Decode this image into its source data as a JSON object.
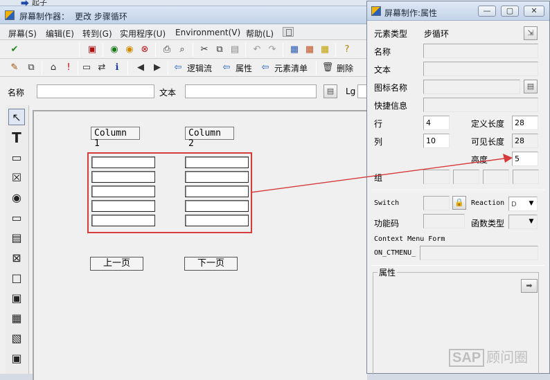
{
  "top": {
    "partial_text": "起子"
  },
  "main": {
    "title": "屏幕制作器：",
    "subtitle": "更改 步骤循环",
    "menu": [
      "屏幕(S)",
      "编辑(E)",
      "转到(G)",
      "实用程序(U)",
      "Environment(V)",
      "帮助(L)"
    ],
    "toolbar2_labels": {
      "flow": "逻辑流",
      "attrs": "属性",
      "elements": "元素清单",
      "delete": "删除"
    },
    "field_labels": {
      "name": "名称",
      "text": "文本",
      "lg": "Lg"
    },
    "columns": [
      "Column 1",
      "Column 2"
    ],
    "buttons": {
      "prev": "上一页",
      "next": "下一页"
    }
  },
  "props": {
    "title": "屏幕制作:属性",
    "element_type_label": "元素类型",
    "element_type_value": "步循环",
    "name_label": "名称",
    "text_label": "文本",
    "icon_label": "图标名称",
    "quickinfo_label": "快捷信息",
    "row_label": "行",
    "row_value": "4",
    "col_label": "列",
    "col_value": "10",
    "deflen_label": "定义长度",
    "deflen_value": "28",
    "vislen_label": "可见长度",
    "vislen_value": "28",
    "height_label": "高度",
    "height_value": "5",
    "group_label": "组",
    "switch_label": "Switch",
    "reaction_label": "Reaction",
    "reaction_value": "D",
    "fcode_label": "功能码",
    "ftype_label": "函数类型",
    "ctxmenu_label": "Context Menu Form",
    "ctxmenu_prefix": "ON_CTMENU_",
    "attr_group_label": "属性"
  },
  "watermark": {
    "box": "SAP",
    "text": "顾问圈"
  },
  "colors": {
    "highlight": "#d63a3a",
    "titlebar": "#c4d4e9"
  }
}
